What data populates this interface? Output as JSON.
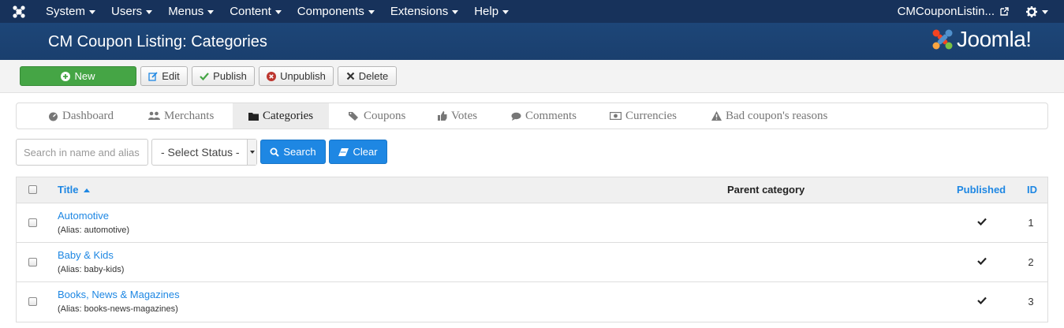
{
  "nav": {
    "menus": [
      {
        "label": "System"
      },
      {
        "label": "Users"
      },
      {
        "label": "Menus"
      },
      {
        "label": "Content"
      },
      {
        "label": "Components"
      },
      {
        "label": "Extensions"
      },
      {
        "label": "Help"
      }
    ],
    "site_name": "CMCouponListin...",
    "bar_color": "#17325b"
  },
  "header": {
    "title": "CM Coupon Listing: Categories",
    "brand": "Joomla!"
  },
  "toolbar": {
    "new_label": "New",
    "edit_label": "Edit",
    "publish_label": "Publish",
    "unpublish_label": "Unpublish",
    "delete_label": "Delete"
  },
  "tabs": [
    {
      "label": "Dashboard",
      "icon": "dashboard-icon"
    },
    {
      "label": "Merchants",
      "icon": "users-icon"
    },
    {
      "label": "Categories",
      "icon": "folder-icon",
      "active": true
    },
    {
      "label": "Coupons",
      "icon": "tags-icon"
    },
    {
      "label": "Votes",
      "icon": "thumbs-up-icon"
    },
    {
      "label": "Comments",
      "icon": "comments-icon"
    },
    {
      "label": "Currencies",
      "icon": "money-icon"
    },
    {
      "label": "Bad coupon's reasons",
      "icon": "warning-icon"
    }
  ],
  "filters": {
    "search_placeholder": "Search in name and alias",
    "status_select": "- Select Status -",
    "search_button": "Search",
    "clear_button": "Clear"
  },
  "table": {
    "columns": {
      "title": "Title",
      "parent": "Parent category",
      "published": "Published",
      "id": "ID"
    },
    "rows": [
      {
        "title": "Automotive",
        "alias": "(Alias: automotive)",
        "published": true,
        "id": "1"
      },
      {
        "title": "Baby & Kids",
        "alias": "(Alias: baby-kids)",
        "published": true,
        "id": "2"
      },
      {
        "title": "Books, News & Magazines",
        "alias": "(Alias: books-news-magazines)",
        "published": true,
        "id": "3"
      }
    ]
  },
  "colors": {
    "accent": "#1e87e3",
    "new_button": "#45a545",
    "header": "#1d4678"
  }
}
